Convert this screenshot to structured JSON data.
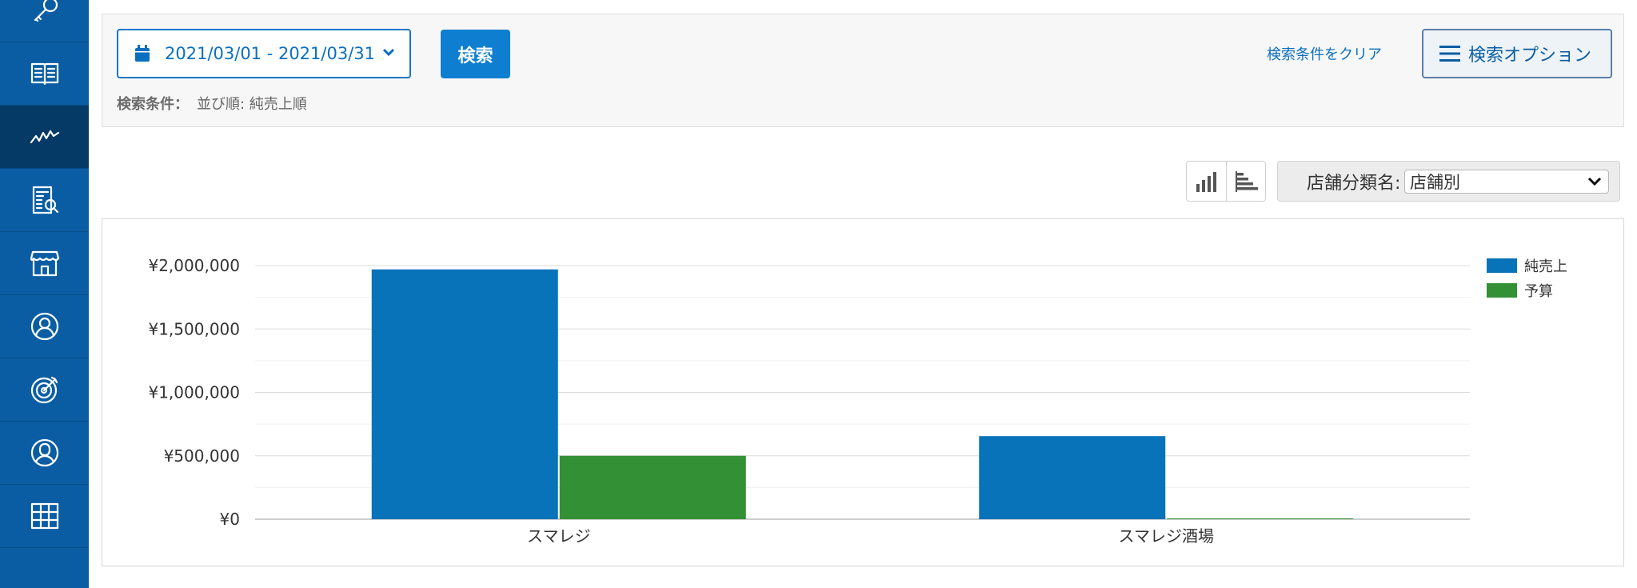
{
  "sidebar": {
    "items": [
      {
        "icon": "key-icon"
      },
      {
        "icon": "book-icon"
      },
      {
        "icon": "chart-line-icon",
        "active": true
      },
      {
        "icon": "report-search-icon"
      },
      {
        "icon": "store-icon"
      },
      {
        "icon": "person-circle-icon"
      },
      {
        "icon": "target-icon"
      },
      {
        "icon": "customer-icon"
      },
      {
        "icon": "grid-gift-icon"
      }
    ]
  },
  "search": {
    "date_range": "2021/03/01 - 2021/03/31",
    "search_label": "検索",
    "clear_label": "検索条件をクリア",
    "options_label": "検索オプション",
    "criteria_label": "検索条件：",
    "criteria_value": "並び順: 純売上順"
  },
  "store_filter": {
    "label": "店舗分類名:",
    "selected": "店舗別"
  },
  "colors": {
    "accent": "#0e7fd0",
    "sidebar": "#0a5da3",
    "series_sales": "#0873b9",
    "series_budget": "#339035"
  },
  "chart_data": {
    "type": "bar",
    "categories": [
      "スマレジ",
      "スマレジ酒場"
    ],
    "series": [
      {
        "name": "純売上",
        "color": "#0873b9",
        "values": [
          1970000,
          655000
        ]
      },
      {
        "name": "予算",
        "color": "#339035",
        "values": [
          500000,
          0
        ]
      }
    ],
    "ylim": [
      0,
      2000000
    ],
    "yticks": [
      {
        "value": 0,
        "label": "¥0"
      },
      {
        "value": 500000,
        "label": "¥500,000"
      },
      {
        "value": 1000000,
        "label": "¥1,000,000"
      },
      {
        "value": 1500000,
        "label": "¥1,500,000"
      },
      {
        "value": 2000000,
        "label": "¥2,000,000"
      }
    ],
    "minor_grid": true,
    "legend_position": "top-right"
  }
}
